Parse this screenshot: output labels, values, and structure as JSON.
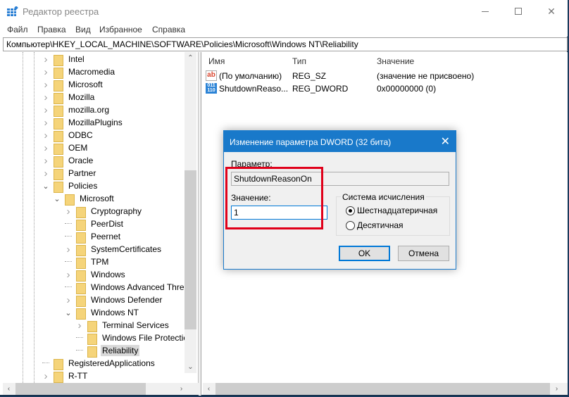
{
  "window": {
    "title": "Редактор реестра",
    "controls": {
      "minimize": "minimize-icon",
      "maximize": "maximize-icon",
      "close": "close-icon"
    }
  },
  "menu": [
    "Файл",
    "Правка",
    "Вид",
    "Избранное",
    "Справка"
  ],
  "address": "Компьютер\\HKEY_LOCAL_MACHINE\\SOFTWARE\\Policies\\Microsoft\\Windows NT\\Reliability",
  "tree": [
    {
      "label": "Intel",
      "level": 0,
      "expander": "collapsed"
    },
    {
      "label": "Macromedia",
      "level": 0,
      "expander": "collapsed"
    },
    {
      "label": "Microsoft",
      "level": 0,
      "expander": "collapsed"
    },
    {
      "label": "Mozilla",
      "level": 0,
      "expander": "collapsed"
    },
    {
      "label": "mozilla.org",
      "level": 0,
      "expander": "collapsed"
    },
    {
      "label": "MozillaPlugins",
      "level": 0,
      "expander": "collapsed"
    },
    {
      "label": "ODBC",
      "level": 0,
      "expander": "collapsed"
    },
    {
      "label": "OEM",
      "level": 0,
      "expander": "collapsed"
    },
    {
      "label": "Oracle",
      "level": 0,
      "expander": "collapsed"
    },
    {
      "label": "Partner",
      "level": 0,
      "expander": "collapsed"
    },
    {
      "label": "Policies",
      "level": 0,
      "expander": "expanded"
    },
    {
      "label": "Microsoft",
      "level": 1,
      "expander": "expanded"
    },
    {
      "label": "Cryptography",
      "level": 2,
      "expander": "collapsed"
    },
    {
      "label": "PeerDist",
      "level": 2,
      "expander": "none"
    },
    {
      "label": "Peernet",
      "level": 2,
      "expander": "none"
    },
    {
      "label": "SystemCertificates",
      "level": 2,
      "expander": "collapsed"
    },
    {
      "label": "TPM",
      "level": 2,
      "expander": "none"
    },
    {
      "label": "Windows",
      "level": 2,
      "expander": "collapsed"
    },
    {
      "label": "Windows Advanced Threat",
      "level": 2,
      "expander": "none"
    },
    {
      "label": "Windows Defender",
      "level": 2,
      "expander": "collapsed"
    },
    {
      "label": "Windows NT",
      "level": 2,
      "expander": "expanded"
    },
    {
      "label": "Terminal Services",
      "level": 3,
      "expander": "collapsed"
    },
    {
      "label": "Windows File Protection",
      "level": 3,
      "expander": "none"
    },
    {
      "label": "Reliability",
      "level": 3,
      "expander": "none",
      "selected": true
    },
    {
      "label": "RegisteredApplications",
      "level": 0,
      "expander": "none"
    },
    {
      "label": "R-TT",
      "level": 0,
      "expander": "collapsed"
    }
  ],
  "list": {
    "columns": [
      "Имя",
      "Тип",
      "Значение"
    ],
    "rows": [
      {
        "icon": "string-value-icon",
        "name": "(По умолчанию)",
        "type": "REG_SZ",
        "value": "(значение не присвоено)"
      },
      {
        "icon": "binary-value-icon",
        "name": "ShutdownReaso...",
        "type": "REG_DWORD",
        "value": "0x00000000 (0)"
      }
    ]
  },
  "dialog": {
    "title": "Изменение параметра DWORD (32 бита)",
    "param_label": "Параметр:",
    "param_value": "ShutdownReasonOn",
    "value_label": "Значение:",
    "value": "1",
    "base_group_label": "Система исчисления",
    "radio_hex": "Шестнадцатеричная",
    "radio_dec": "Десятичная",
    "selected_base": "hex",
    "ok": "OK",
    "cancel": "Отмена"
  },
  "colors": {
    "accent": "#1979ca",
    "highlight": "#e0001a",
    "folder": "#f5d47a"
  }
}
